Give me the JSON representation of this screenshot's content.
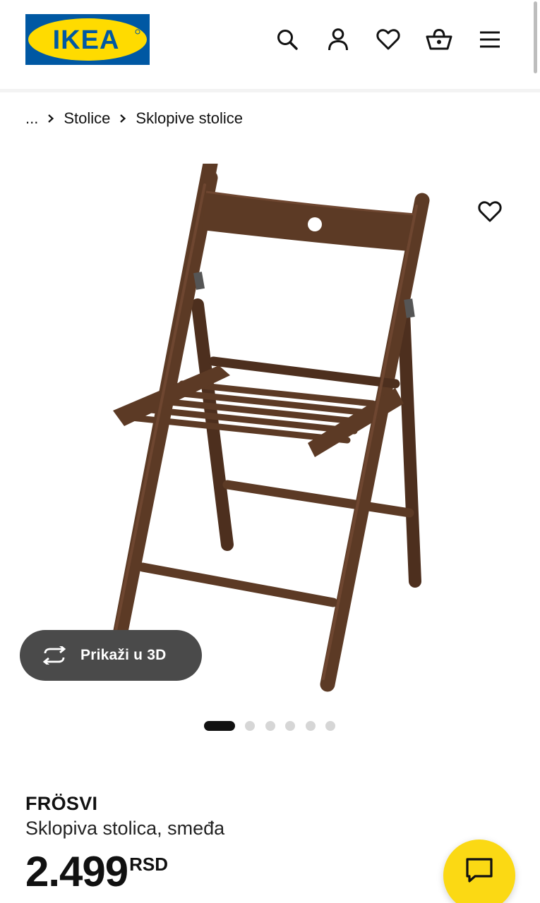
{
  "header": {
    "logo_text": "IKEA",
    "icons": [
      "search-icon",
      "account-icon",
      "wishlist-heart-icon",
      "shopping-basket-icon",
      "menu-icon"
    ]
  },
  "breadcrumb": {
    "ellipsis": "...",
    "items": [
      "Stolice",
      "Sklopive stolice"
    ]
  },
  "gallery": {
    "view_3d_label": "Prikaži u 3D",
    "slide_count": 6,
    "active_slide": 1
  },
  "product": {
    "name": "FRÖSVI",
    "description": "Sklopiva stolica, smeđa",
    "price": "2.499",
    "currency": "RSD"
  },
  "colors": {
    "ikea_blue": "#0058a3",
    "ikea_yellow": "#ffdb00",
    "chat_button": "#fbd914",
    "chair_wood": "#5c3a25"
  }
}
